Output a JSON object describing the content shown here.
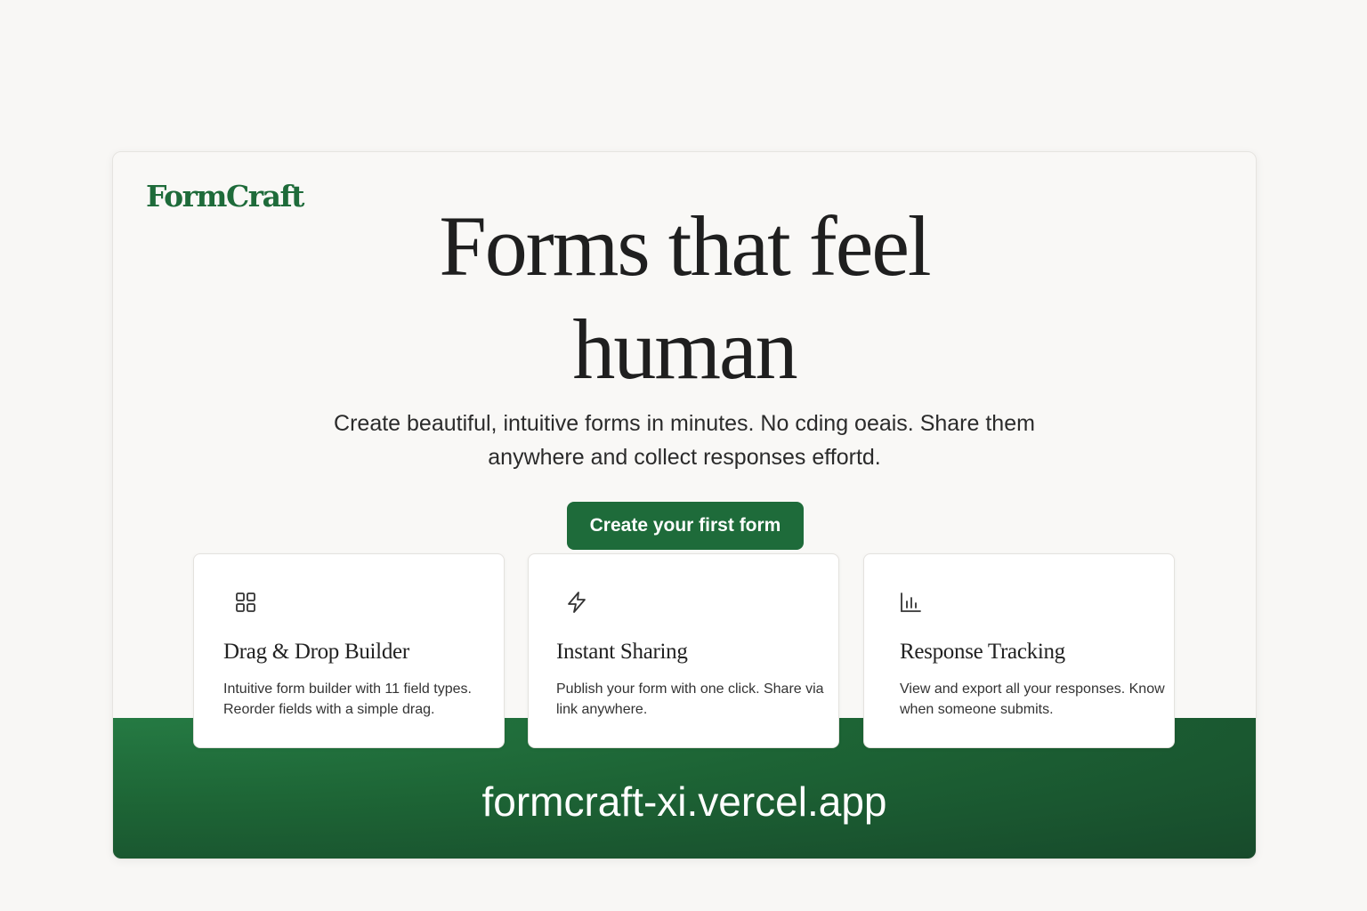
{
  "brand": {
    "logo_text": "FormCraft",
    "accent_color": "#1e6b3a"
  },
  "hero": {
    "headline_line1": "Forms that feel",
    "headline_line2": "human",
    "subtitle": "Create beautiful, intuitive forms in minutes. No cding oeais. Share them anywhere and collect responses effortd.",
    "cta_label": "Create your first form"
  },
  "features": [
    {
      "icon": "grid-icon",
      "title": "Drag & Drop Builder",
      "description": "Intuitive form builder with 11 field types. Reorder fields with a simple drag."
    },
    {
      "icon": "lightning-icon",
      "title": "Instant Sharing",
      "description": "Publish your form with one click. Share via link anywhere."
    },
    {
      "icon": "bar-chart-icon",
      "title": "Response Tracking",
      "description": "View and export all your responses. Know when someone submits."
    }
  ],
  "footer": {
    "url": "formcraft-xi.vercel.app"
  }
}
